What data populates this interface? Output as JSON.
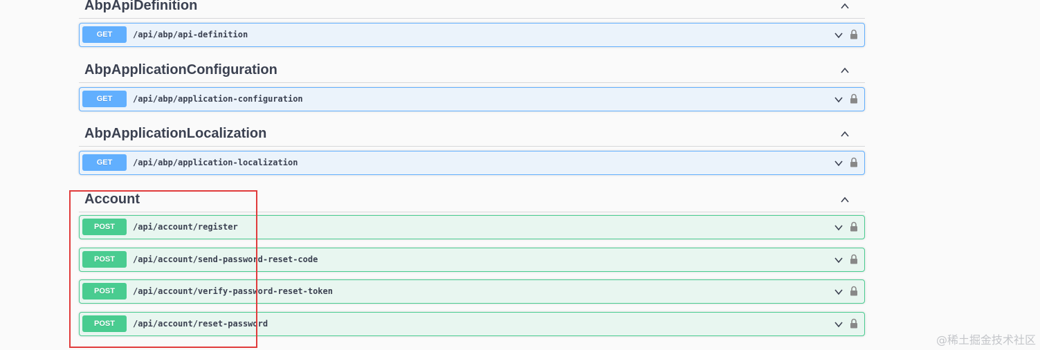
{
  "sections": [
    {
      "title": "AbpApiDefinition",
      "operations": [
        {
          "method": "GET",
          "path": "/api/abp/api-definition"
        }
      ]
    },
    {
      "title": "AbpApplicationConfiguration",
      "operations": [
        {
          "method": "GET",
          "path": "/api/abp/application-configuration"
        }
      ]
    },
    {
      "title": "AbpApplicationLocalization",
      "operations": [
        {
          "method": "GET",
          "path": "/api/abp/application-localization"
        }
      ]
    },
    {
      "title": "Account",
      "operations": [
        {
          "method": "POST",
          "path": "/api/account/register"
        },
        {
          "method": "POST",
          "path": "/api/account/send-password-reset-code"
        },
        {
          "method": "POST",
          "path": "/api/account/verify-password-reset-token"
        },
        {
          "method": "POST",
          "path": "/api/account/reset-password"
        }
      ]
    }
  ],
  "watermark": "@稀土掘金技术社区",
  "colors": {
    "get": "#61affe",
    "post": "#49cc90",
    "highlight": "#e03a3a"
  },
  "icons": {
    "section_toggle": "chevron-up-icon",
    "operation_expand": "chevron-down-icon",
    "auth": "lock-icon"
  }
}
